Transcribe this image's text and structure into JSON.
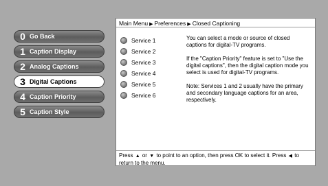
{
  "menu": {
    "items": [
      {
        "num": "0",
        "label": "Go Back"
      },
      {
        "num": "1",
        "label": "Caption Display"
      },
      {
        "num": "2",
        "label": "Analog Captions"
      },
      {
        "num": "3",
        "label": "Digital Captions"
      },
      {
        "num": "4",
        "label": "Caption Priority"
      },
      {
        "num": "5",
        "label": "Caption Style"
      }
    ],
    "selected": "3"
  },
  "breadcrumb": {
    "items": [
      "Main Menu",
      "Preferences",
      "Closed Captioning"
    ]
  },
  "services": [
    "Service 1",
    "Service 2",
    "Service 3",
    "Service 4",
    "Service 5",
    "Service 6"
  ],
  "description": {
    "p1": "You can select a mode or source of closed captions for digital-TV programs.",
    "p2": "If the \"Caption Priority\" feature is set to \"Use the digital captions\", then the digital caption mode you select is used for digital-TV programs.",
    "p3": "Note: Services 1 and 2 usually have the primary and secondary language captions for an area, respectively."
  },
  "footer": {
    "t1": "Press",
    "t2": "or",
    "t3": "to point to an option, then press OK to select it. Press",
    "t4": "to return to the menu."
  }
}
